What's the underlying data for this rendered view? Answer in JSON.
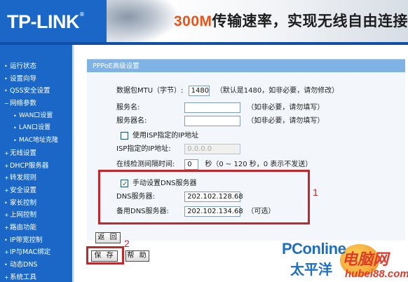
{
  "header": {
    "logo": "TP-LINK",
    "logo_mark": "®",
    "slogan_highlight": "300M",
    "slogan_rest": "传输速率，实现无线自由连接"
  },
  "sidebar": {
    "items": [
      {
        "label": "运行状态",
        "sub": false,
        "bullet": "•"
      },
      {
        "label": "设置向导",
        "sub": false,
        "bullet": "•"
      },
      {
        "label": "QSS安全设置",
        "sub": false,
        "bullet": "•"
      },
      {
        "label": "网络参数",
        "sub": false,
        "bullet": "−"
      },
      {
        "label": "WAN口设置",
        "sub": true,
        "bullet": "•"
      },
      {
        "label": "LAN口设置",
        "sub": true,
        "bullet": "•"
      },
      {
        "label": "MAC地址克隆",
        "sub": true,
        "bullet": "•"
      },
      {
        "label": "无线设置",
        "sub": false,
        "bullet": "+"
      },
      {
        "label": "DHCP服务器",
        "sub": false,
        "bullet": "+"
      },
      {
        "label": "转发规则",
        "sub": false,
        "bullet": "+"
      },
      {
        "label": "安全设置",
        "sub": false,
        "bullet": "+"
      },
      {
        "label": "家长控制",
        "sub": false,
        "bullet": "•"
      },
      {
        "label": "上网控制",
        "sub": false,
        "bullet": "+"
      },
      {
        "label": "路由功能",
        "sub": false,
        "bullet": "+"
      },
      {
        "label": "IP带宽控制",
        "sub": false,
        "bullet": "•"
      },
      {
        "label": "IP与MAC绑定",
        "sub": false,
        "bullet": "+"
      },
      {
        "label": "动态DNS",
        "sub": false,
        "bullet": "•"
      },
      {
        "label": "系统工具",
        "sub": false,
        "bullet": "+"
      }
    ]
  },
  "panel": {
    "title": "PPPoE高级设置",
    "mtu": {
      "label": "数据包MTU（字节）:",
      "value": "1480",
      "hint": "（默认是1480，如非必要，请勿修改）"
    },
    "service_name": {
      "label": "服务名:",
      "value": "",
      "hint": "（如非必要，请勿填写）"
    },
    "server_name": {
      "label": "服务器名:",
      "value": "",
      "hint": "（如非必要，请勿填写）"
    },
    "isp_ip_checkbox": {
      "label": "使用ISP指定的IP地址",
      "checked": false
    },
    "isp_ip": {
      "label": "ISP指定的IP地址:",
      "placeholder": "0.0.0.0"
    },
    "idle_interval": {
      "label": "在线检测间隔时间:",
      "value": "0",
      "hint": "秒（0 ~ 120 秒，0 表示不发送）"
    },
    "manual_dns_checkbox": {
      "label": "手动设置DNS服务器",
      "checked": true
    },
    "dns_primary": {
      "label": "DNS服务器:",
      "value": "202.102.128.68"
    },
    "dns_secondary": {
      "label": "备用DNS服务器:",
      "value": "202.102.134.68",
      "hint": "（可选）"
    },
    "back_button": "返 回",
    "save_button": "保 存",
    "help_button": "帮 助"
  },
  "annotations": {
    "dns_box_label": "1",
    "save_box_label": "2"
  },
  "watermark": {
    "site": "PConline",
    "site_cn": "太平洋",
    "brand": "电脑网",
    "url": "hubei88.com"
  },
  "colors": {
    "sidebar_bg": "#1a67c8",
    "panel_title_bg": "#7fb2e5",
    "highlight_red": "#c0282d",
    "slogan_orange": "#e8541b"
  }
}
